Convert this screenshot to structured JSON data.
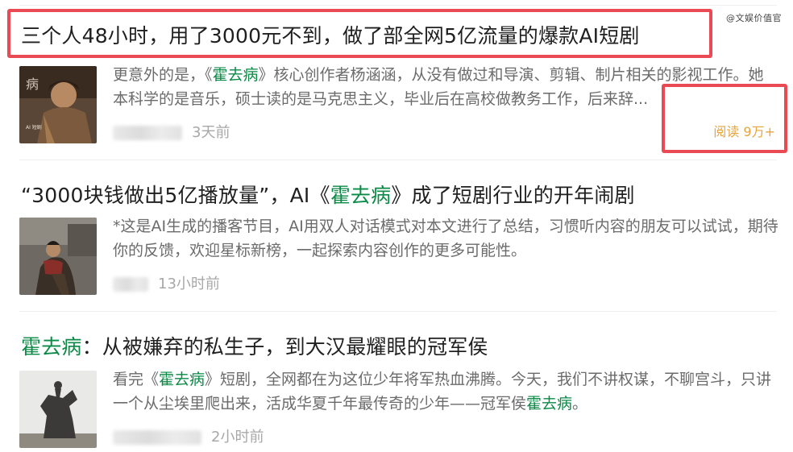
{
  "watermark": "@文娱价值官",
  "articles": [
    {
      "title_pre": "三个人48小时，用了3000元不到，做了部全网5亿流量的爆款AI短剧",
      "summary": [
        "更意外的是，《",
        "霍去病",
        "》核心创作者杨涵涵，从没有做过和导演、剪辑、制片相关的影视工作。她本科学的是音乐，硕士读的是马克思主义，毕业后在高校做教务工作，后来辞..."
      ],
      "time": "3天前",
      "reads": "阅读 9万+"
    },
    {
      "title_pre": "“3000块钱做出5亿播放量”，AI《",
      "title_kw": "霍去病",
      "title_post": "》成了短剧行业的开年闹剧",
      "summary": "*这是AI生成的播客节目，AI用双人对话模式对本文进行了总结，习惯听内容的朋友可以试试，期待你的反馈，欢迎星标新榜，一起探索内容创作的更多可能性。",
      "time": "13小时前"
    },
    {
      "title_kw": "霍去病",
      "title_post": "：从被嫌弃的私生子，到大汉最耀眼的冠军侯",
      "summary": [
        "看完《",
        "霍去病",
        "》短剧，全网都在为这位少年将军热血沸腾。今天，我们不讲权谋，不聊宫斗，只讲一个从尘埃里爬出来，活成华夏千年最传奇的少年——冠军侯",
        "霍去病",
        "。"
      ],
      "time": "2小时前"
    }
  ],
  "colors": {
    "keyword": "#0a8a45",
    "highlight": "#ea4a53",
    "reads": "#e8a43a"
  }
}
